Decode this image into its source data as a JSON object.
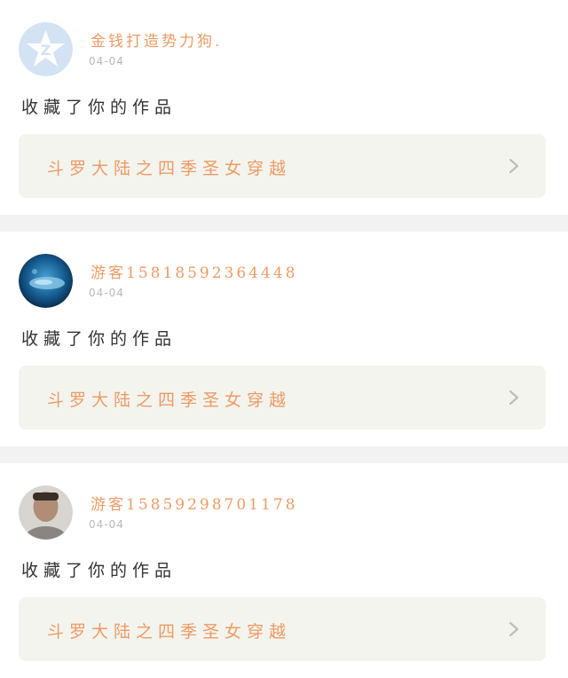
{
  "items": [
    {
      "avatar": "qq-default-avatar",
      "username": "金钱打造势力狗.",
      "date": "04-04",
      "action": "收藏了你的作品",
      "work_title": "斗罗大陆之四季圣女穿越"
    },
    {
      "avatar": "fish-photo-avatar",
      "username": "游客15818592364448",
      "date": "04-04",
      "action": "收藏了你的作品",
      "work_title": "斗罗大陆之四季圣女穿越"
    },
    {
      "avatar": "person-photo-avatar",
      "username": "游客15859298701178",
      "date": "04-04",
      "action": "收藏了你的作品",
      "work_title": "斗罗大陆之四季圣女穿越"
    }
  ],
  "colors": {
    "accent": "#ee9b64",
    "date": "#b9b9b9",
    "text": "#333333",
    "box": "#f4f4ef"
  },
  "icons": {
    "chevron": "chevron-right-icon"
  }
}
